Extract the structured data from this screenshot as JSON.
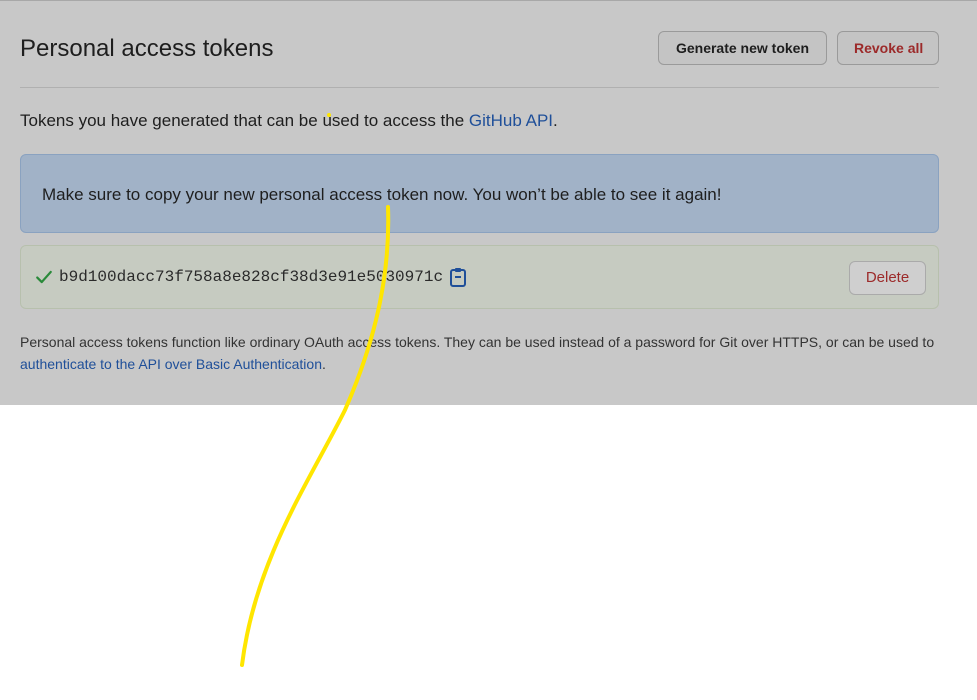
{
  "header": {
    "title": "Personal access tokens",
    "generate_button": "Generate new token",
    "revoke_button": "Revoke all"
  },
  "intro": {
    "text_before_link": "Tokens you have generated that can be used to access the ",
    "link_text": "GitHub API",
    "text_after_link": "."
  },
  "flash": {
    "message": "Make sure to copy your new personal access token now. You won’t be able to see it again!"
  },
  "token": {
    "value": "b9d100dacc73f758a8e828cf38d3e91e5030971c",
    "delete_button": "Delete",
    "status_icon": "check-icon",
    "copy_icon": "clipboard-icon"
  },
  "help": {
    "text_before_link": "Personal access tokens function like ordinary OAuth access tokens. They can be used instead of a password for Git over HTTPS, or can be used to ",
    "link_text": "authenticate to the API over Basic Authentication",
    "text_after_link": "."
  },
  "colors": {
    "overlay": "#c8c8c8",
    "link": "#1f4f99",
    "danger": "#9c2a2a",
    "success": "#2a8a3a",
    "flash_info": "#a1b2c7",
    "annotation_stroke": "#ffe600"
  }
}
